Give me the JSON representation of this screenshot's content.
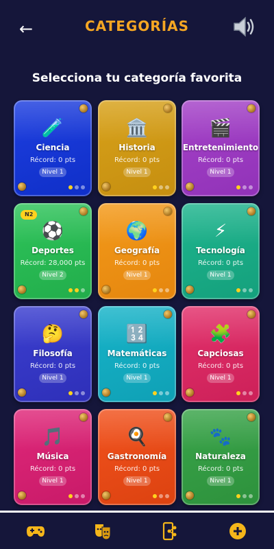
{
  "header": {
    "back_icon": "arrow-left-icon",
    "title": "CATEGORÍAS",
    "sound_icon": "speaker-icon"
  },
  "subtitle": "Selecciona tu categoría favorita",
  "categories": [
    {
      "name": "Ciencia",
      "icon": "🧪",
      "record": "Récord: 0 pts",
      "level": "Nivel 1",
      "progress": 1,
      "color": "#1e3fe0",
      "color2": "#0f2fc8"
    },
    {
      "name": "Historia",
      "icon": "🏛️",
      "record": "Récord: 0 pts",
      "level": "Nivel 1",
      "progress": 1,
      "color": "#d8a21a",
      "color2": "#c58e10"
    },
    {
      "name": "Entretenimiento",
      "icon": "🎬",
      "record": "Récord: 0 pts",
      "level": "Nivel 1",
      "progress": 1,
      "color": "#a543c8",
      "color2": "#9132b8"
    },
    {
      "name": "Deportes",
      "icon": "⚽",
      "record": "Récord: 28,000 pts",
      "level": "Nivel 2",
      "progress": 2,
      "badge": "N2",
      "color": "#2ec45a",
      "color2": "#22ad4b"
    },
    {
      "name": "Geografía",
      "icon": "🌍",
      "record": "Récord: 0 pts",
      "level": "Nivel 1",
      "progress": 1,
      "color": "#f39a1a",
      "color2": "#e5860e"
    },
    {
      "name": "Tecnología",
      "icon": "⚡",
      "record": "Récord: 0 pts",
      "level": "Nivel 1",
      "progress": 1,
      "color": "#1fb58e",
      "color2": "#14a07c"
    },
    {
      "name": "Filosofía",
      "icon": "🤔",
      "record": "Récord: 0 pts",
      "level": "Nivel 1",
      "progress": 1,
      "color": "#3b3fd0",
      "color2": "#2e2fb8"
    },
    {
      "name": "Matemáticas",
      "icon": "🔢",
      "record": "Récord: 0 pts",
      "level": "Nivel 1",
      "progress": 1,
      "color": "#17b4c9",
      "color2": "#0fa0b5"
    },
    {
      "name": "Capciosas",
      "icon": "🧩",
      "record": "Récord: 0 pts",
      "level": "Nivel 1",
      "progress": 1,
      "color": "#e3316c",
      "color2": "#cc2058"
    },
    {
      "name": "Música",
      "icon": "🎵",
      "record": "Récord: 0 pts",
      "level": "Nivel 1",
      "progress": 1,
      "color": "#e0287a",
      "color2": "#c81a68"
    },
    {
      "name": "Gastronomía",
      "icon": "🍳",
      "record": "Récord: 0 pts",
      "level": "Nivel 1",
      "progress": 1,
      "color": "#f2531e",
      "color2": "#dc4210"
    },
    {
      "name": "Naturaleza",
      "icon": "🐾",
      "record": "Récord: 0 pts",
      "level": "Nivel 1",
      "progress": 1,
      "color": "#3aa54a",
      "color2": "#2d913c"
    }
  ],
  "nav": {
    "items": [
      {
        "name": "gamepad-icon"
      },
      {
        "name": "theater-masks-icon"
      },
      {
        "name": "phone-share-icon"
      },
      {
        "name": "add-circle-icon"
      }
    ],
    "accent": "#f5b61a"
  }
}
